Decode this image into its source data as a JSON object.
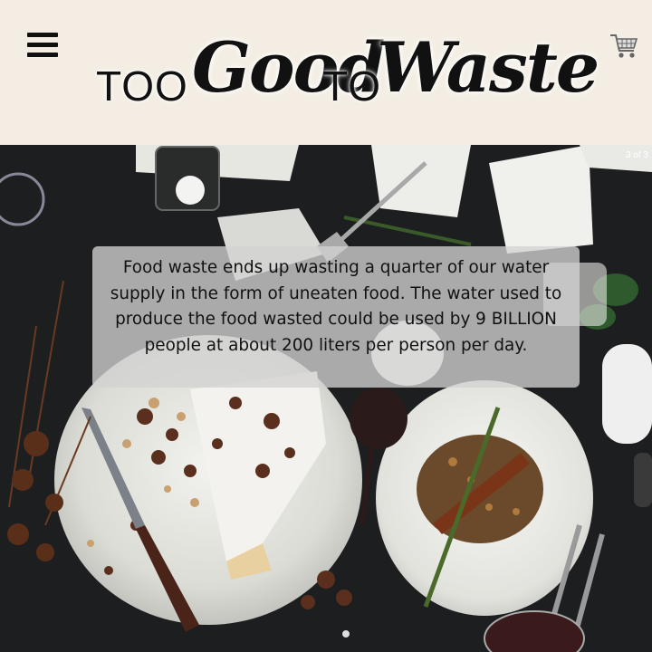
{
  "header": {
    "logo": {
      "word1": "TOO",
      "word2": "Good",
      "word3": "TO",
      "word4": "Waste"
    },
    "menu_icon": "hamburger-menu-icon",
    "cart_icon": "shopping-cart-icon"
  },
  "hero": {
    "slide_counter": "3 of 3",
    "caption": "Food waste ends up wasting a quarter of our water supply in the form of uneaten food. The water used to produce the food wasted could be used by 9 BILLION people at about 200 liters per person per day."
  },
  "colors": {
    "header_bg": "#f3ede3",
    "logo_text": "#111111",
    "caption_bg": "#d2d2d2"
  }
}
